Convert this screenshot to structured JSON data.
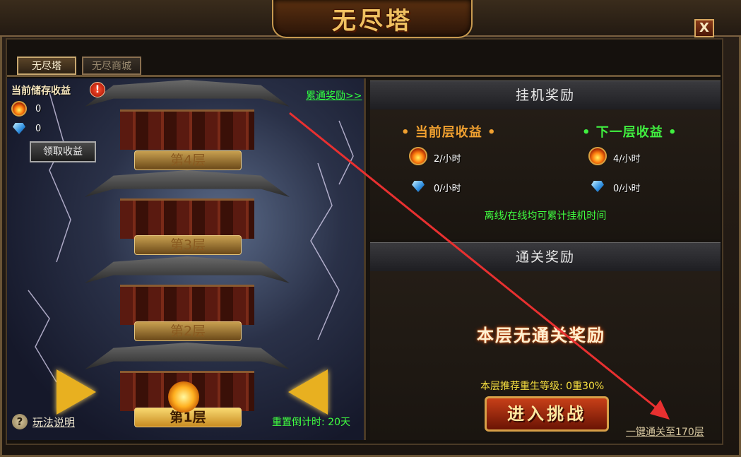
{
  "window": {
    "title": "无尽塔",
    "close_label": "X"
  },
  "tabs": [
    {
      "label": "无尽塔",
      "active": true
    },
    {
      "label": "无尽商城",
      "active": false
    }
  ],
  "stored_income": {
    "title": "当前储存收益",
    "fire_value": "0",
    "gem_value": "0",
    "claim_button": "领取收益",
    "warning_icon": "!"
  },
  "cumulative_link": "累通奖励>>",
  "tower": {
    "floors": [
      "第4层",
      "第3层",
      "第2层",
      "第1层"
    ],
    "current_floor": "第1层"
  },
  "help_icon": "?",
  "help_link": "玩法说明",
  "reset_countdown": "重置倒计时: 20天",
  "afk_reward": {
    "header": "挂机奖励",
    "current_title": "• 当前层收益 •",
    "next_title": "• 下一层收益 •",
    "current_fire": "2/小时",
    "current_gem": "0/小时",
    "next_fire": "4/小时",
    "next_gem": "0/小时",
    "note": "离线/在线均可累计挂机时间"
  },
  "clear_reward": {
    "header": "通关奖励",
    "none_text": "本层无通关奖励",
    "recommend": "本层推荐重生等级: 0重30%",
    "challenge_button": "进入挑战",
    "one_click_clear": "一键通关至170层"
  },
  "colors": {
    "accent_gold": "#f0c060",
    "green_text": "#40ff40",
    "annotation_red": "#e83030"
  },
  "icons": [
    "fire-coin-icon",
    "diamond-icon",
    "warning-icon",
    "help-icon",
    "close-icon"
  ]
}
